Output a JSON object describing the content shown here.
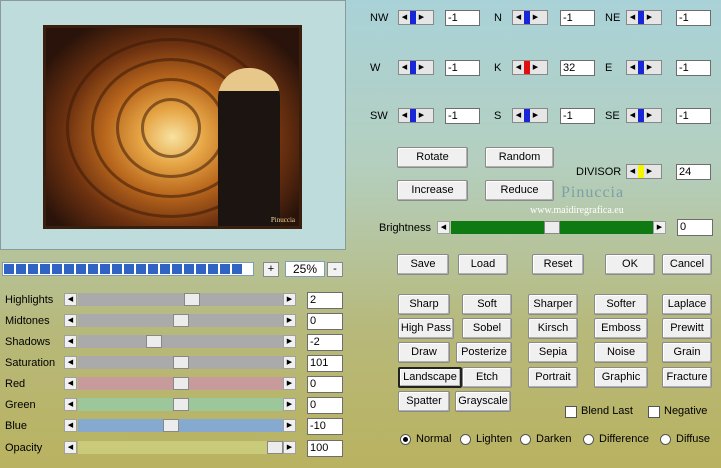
{
  "preview": {
    "watermark": "Pinuccia"
  },
  "zoom": {
    "minus": "-",
    "plus": "+",
    "value": "25%"
  },
  "sliders": [
    {
      "label": "Highlights",
      "value": "2",
      "level": 0.56,
      "color": "#aaaaaa"
    },
    {
      "label": "Midtones",
      "value": "0",
      "level": 0.5,
      "color": "#aaaaaa"
    },
    {
      "label": "Shadows",
      "value": "-2",
      "level": 0.36,
      "color": "#aaaaaa"
    },
    {
      "label": "Saturation",
      "value": "101",
      "level": 0.5,
      "color": "#aaaaaa"
    },
    {
      "label": "Red",
      "value": "0",
      "level": 0.5,
      "color": "#c79a9c"
    },
    {
      "label": "Green",
      "value": "0",
      "level": 0.5,
      "color": "#9cc79a"
    },
    {
      "label": "Blue",
      "value": "-10",
      "level": 0.45,
      "color": "#86a9cf"
    },
    {
      "label": "Opacity",
      "value": "100",
      "level": 1.0,
      "color": "#c9cb7a"
    }
  ],
  "directions": [
    {
      "label": "NW",
      "value": "-1",
      "color": "#1726d6"
    },
    {
      "label": "N",
      "value": "-1",
      "color": "#1726d6"
    },
    {
      "label": "NE",
      "value": "-1",
      "color": "#1726d6"
    },
    {
      "label": "W",
      "value": "-1",
      "color": "#1726d6"
    },
    {
      "label": "K",
      "value": "32",
      "color": "#e01010"
    },
    {
      "label": "E",
      "value": "-1",
      "color": "#1726d6"
    },
    {
      "label": "SW",
      "value": "-1",
      "color": "#1726d6"
    },
    {
      "label": "S",
      "value": "-1",
      "color": "#1726d6"
    },
    {
      "label": "SE",
      "value": "-1",
      "color": "#1726d6"
    }
  ],
  "matrix_buttons": {
    "rotate": "Rotate",
    "random": "Random",
    "increase": "Increase",
    "reduce": "Reduce"
  },
  "divisor": {
    "label": "DIVISOR",
    "value": "24",
    "color": "#f5f500"
  },
  "watermark": {
    "title": "Pinuccia",
    "site": "www.maidiregrafica.eu"
  },
  "brightness": {
    "label": "Brightness",
    "value": "0",
    "level": 0.5,
    "color": "#0f7a12"
  },
  "actions": {
    "save": "Save",
    "load": "Load",
    "reset": "Reset",
    "ok": "OK",
    "cancel": "Cancel"
  },
  "filters": [
    [
      "Sharp",
      "Soft",
      "Sharper",
      "Softer",
      "Laplace"
    ],
    [
      "High Pass",
      "Sobel",
      "Kirsch",
      "Emboss",
      "Prewitt"
    ],
    [
      "Draw",
      "Posterize",
      "Sepia",
      "Noise",
      "Grain"
    ],
    [
      "Landscape",
      "Etch",
      "Portrait",
      "Graphic",
      "Fracture"
    ],
    [
      "Spatter",
      "Grayscale"
    ]
  ],
  "selected_filter": "Landscape",
  "options": {
    "blend_last": "Blend Last",
    "negative": "Negative"
  },
  "blend_modes": [
    "Normal",
    "Lighten",
    "Darken",
    "Difference",
    "Diffuse"
  ],
  "selected_mode": "Normal"
}
